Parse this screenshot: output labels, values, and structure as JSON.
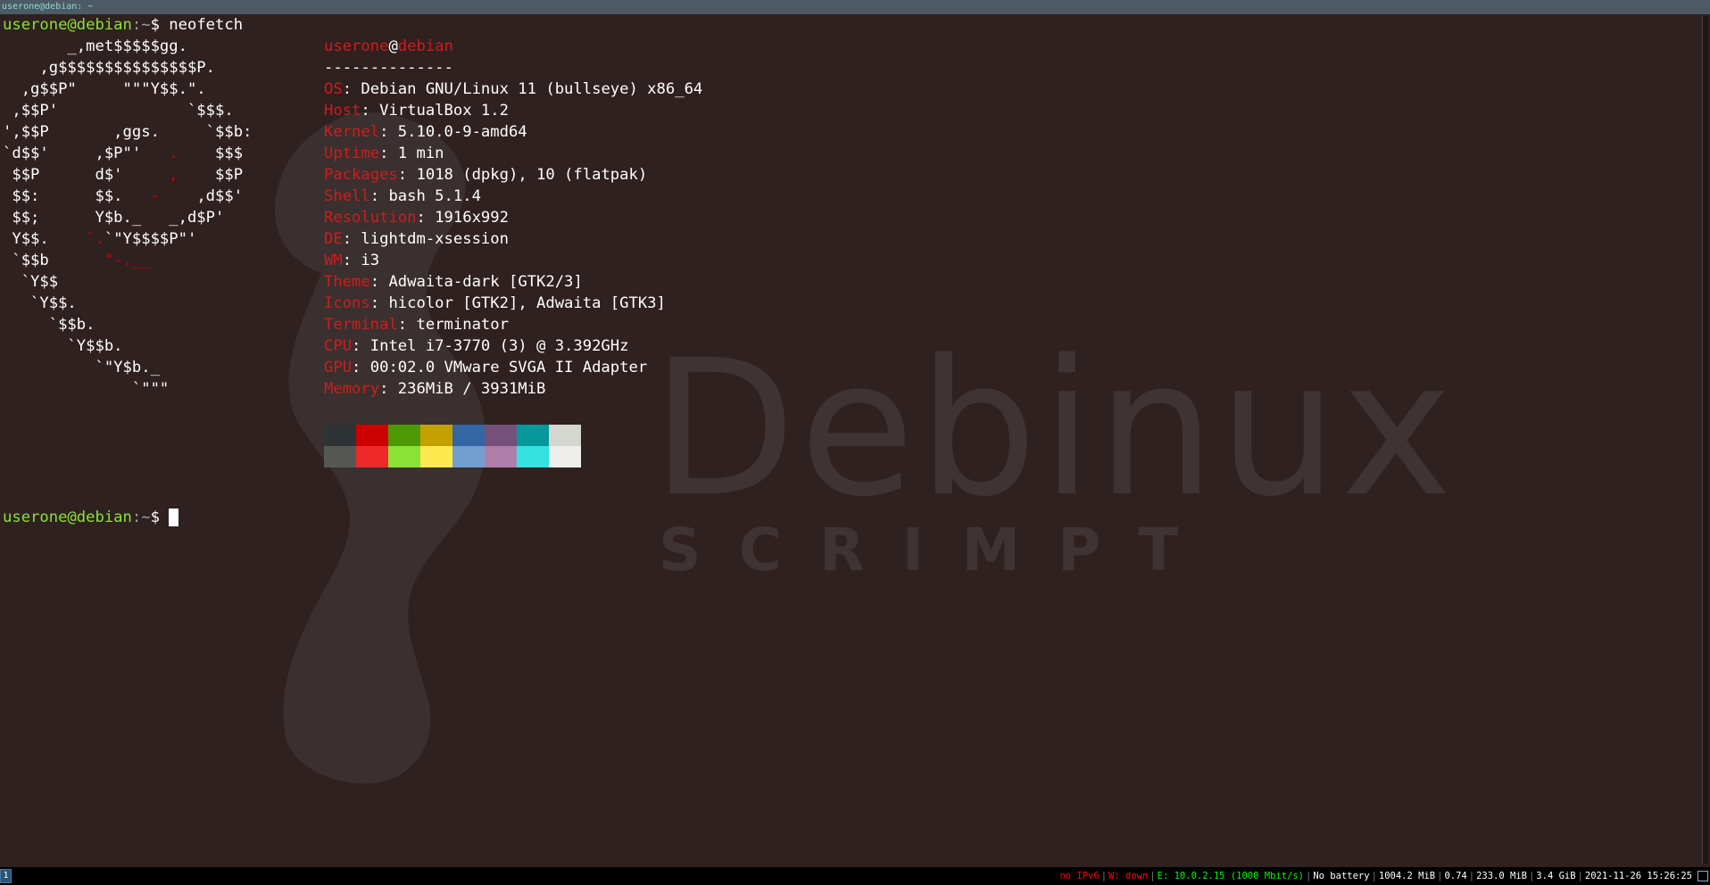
{
  "window": {
    "title": "userone@debian: ~"
  },
  "wallpaper": {
    "logo": "Debinux",
    "subtitle": "SCRIMPT"
  },
  "prompt": {
    "user": "userone@debian",
    "path": ":~",
    "symbol": "$",
    "command": " neofetch"
  },
  "prompt2": {
    "user": "userone@debian",
    "path": ":~",
    "symbol": "$ "
  },
  "logo_lines": [
    {
      "w": "       _,met$$$$$gg.",
      "r": ""
    },
    {
      "w": "    ,g$$$$$$$$$$$$$$$P.",
      "r": ""
    },
    {
      "w": "  ,g$$P\"     \"\"\"Y$$.\".",
      "r": ""
    },
    {
      "w": " ,$$P'              `$$$.",
      "r": ""
    },
    {
      "w": "',$$P       ,ggs.     `$$b:",
      "r": ""
    },
    {
      "w": "`d$$'     ,$P\"'   ",
      "r": ".",
      "w2": "    $$$"
    },
    {
      "w": " $$P      d$'     ",
      "r": ",",
      "w2": "    $$P"
    },
    {
      "w": " $$:      $$.   ",
      "r": "-",
      "w2": "    ,d$$'"
    },
    {
      "w": " $$;      Y$b._   _,d$P'",
      "r": ""
    },
    {
      "w": " Y$$.    ",
      "r": "`.",
      "w2": "`\"Y$$$$P\"'"
    },
    {
      "w": " `$$b      ",
      "r": "\"-.__",
      "w2": ""
    },
    {
      "w": "  `Y$$",
      "r": ""
    },
    {
      "w": "   `Y$$.",
      "r": ""
    },
    {
      "w": "     `$$b.",
      "r": ""
    },
    {
      "w": "       `Y$$b.",
      "r": ""
    },
    {
      "w": "          `\"Y$b._",
      "r": ""
    },
    {
      "w": "              `\"\"\"",
      "r": ""
    }
  ],
  "header": {
    "user": "userone",
    "at": "@",
    "host": "debian",
    "separator": "--------------"
  },
  "info": [
    {
      "label": "OS",
      "value": ": Debian GNU/Linux 11 (bullseye) x86_64"
    },
    {
      "label": "Host",
      "value": ": VirtualBox 1.2"
    },
    {
      "label": "Kernel",
      "value": ": 5.10.0-9-amd64"
    },
    {
      "label": "Uptime",
      "value": ": 1 min"
    },
    {
      "label": "Packages",
      "value": ": 1018 (dpkg), 10 (flatpak)"
    },
    {
      "label": "Shell",
      "value": ": bash 5.1.4"
    },
    {
      "label": "Resolution",
      "value": ": 1916x992"
    },
    {
      "label": "DE",
      "value": ": lightdm-xsession"
    },
    {
      "label": "WM",
      "value": ": i3"
    },
    {
      "label": "Theme",
      "value": ": Adwaita-dark [GTK2/3]"
    },
    {
      "label": "Icons",
      "value": ": hicolor [GTK2], Adwaita [GTK3]"
    },
    {
      "label": "Terminal",
      "value": ": terminator"
    },
    {
      "label": "CPU",
      "value": ": Intel i7-3770 (3) @ 3.392GHz"
    },
    {
      "label": "GPU",
      "value": ": 00:02.0 VMware SVGA II Adapter"
    },
    {
      "label": "Memory",
      "value": ": 236MiB / 3931MiB"
    }
  ],
  "palette": {
    "normal": [
      "#2e3436",
      "#cc0000",
      "#4e9a06",
      "#c4a000",
      "#3465a4",
      "#75507b",
      "#06989a",
      "#d3d7cf"
    ],
    "bright": [
      "#555753",
      "#ef2929",
      "#8ae234",
      "#fce94f",
      "#729fcf",
      "#ad7fa8",
      "#34e2e2",
      "#eeeeec"
    ]
  },
  "statusbar": {
    "workspace": "1",
    "ipv6": "no IPv6",
    "wireless": "W: down",
    "ethernet": "E: 10.0.2.15 (1000 Mbit/s)",
    "battery": "No battery",
    "disk": "1004.2 MiB",
    "load": "0.74",
    "mem_used": "233.0 MiB",
    "mem_total": "3.4 GiB",
    "datetime": "2021-11-26 15:26:25"
  }
}
